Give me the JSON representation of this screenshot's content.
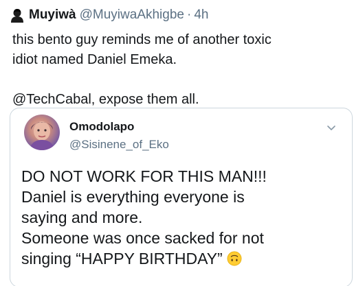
{
  "tweet": {
    "author_name": "Muyiwà",
    "author_handle": "@MuyiwaAkhigbe",
    "separator": "·",
    "time": "4h",
    "text": "this bento guy reminds me of another toxic\nidiot named Daniel Emeka.\n\n@TechCabal, expose them all.",
    "author_icon": "person-silhouette-icon"
  },
  "quoted_tweet": {
    "author_name": "Omodolapo",
    "author_handle": "@Sisinene_of_Eko",
    "text": "DO NOT WORK FOR THIS MAN!!!\nDaniel is everything everyone is\nsaying and more.\nSomeone was once sacked for not\nsinging “HAPPY BIRTHDAY”",
    "emoji": "upside-down-face-emoji",
    "menu_icon": "chevron-down-icon"
  }
}
